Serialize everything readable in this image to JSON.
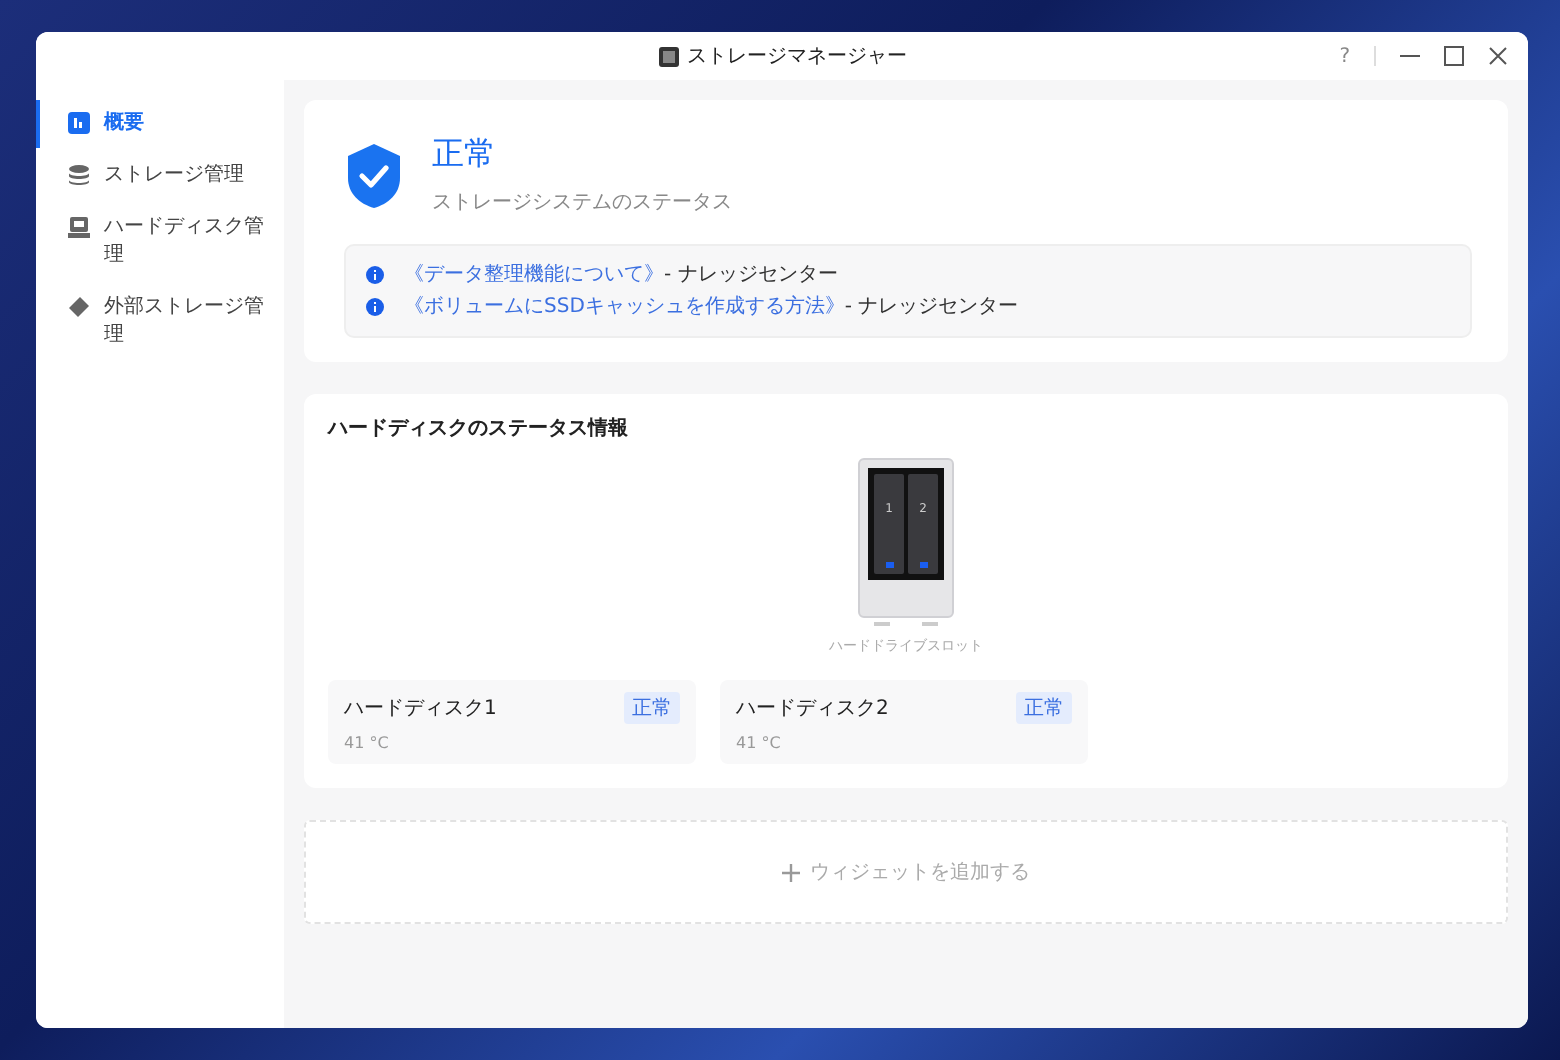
{
  "window": {
    "title": "ストレージマネージャー",
    "help": "?"
  },
  "sidebar": {
    "items": [
      {
        "label": "概要",
        "selected": true
      },
      {
        "label": "ストレージ管理",
        "selected": false
      },
      {
        "label": "ハードディスク管理",
        "selected": false
      },
      {
        "label": "外部ストレージ管理",
        "selected": false
      }
    ]
  },
  "status": {
    "title": "正常",
    "subtitle": "ストレージシステムのステータス",
    "links": [
      {
        "link": "《データ整理機能について》",
        "suffix": " - ナレッジセンター"
      },
      {
        "link": "《ボリュームにSSDキャッシュを作成する方法》",
        "suffix": " - ナレッジセンター"
      }
    ]
  },
  "disks": {
    "title": "ハードディスクのステータス情報",
    "slots": [
      "1",
      "2"
    ],
    "device_caption": "ハードドライブスロット",
    "items": [
      {
        "name": "ハードディスク1",
        "status": "正常",
        "temperature": "41 °C"
      },
      {
        "name": "ハードディスク2",
        "status": "正常",
        "temperature": "41 °C"
      }
    ]
  },
  "add_widget": {
    "label": "ウィジェットを追加する"
  }
}
